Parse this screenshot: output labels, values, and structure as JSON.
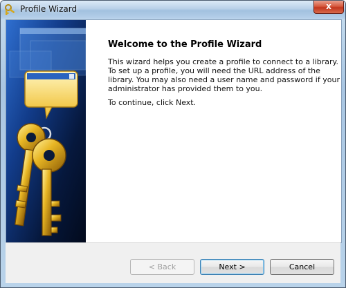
{
  "window": {
    "title": "Profile Wizard",
    "close_glyph": "x"
  },
  "page": {
    "heading": "Welcome to the Profile Wizard",
    "intro": "This wizard helps you create a profile to connect to a library. To set up a profile, you will need the URL address of the library. You may also need a user name and password if your administrator has provided them to you.",
    "continue_text": "To continue, click Next."
  },
  "buttons": {
    "back": "< Back",
    "next": "Next >",
    "cancel": "Cancel"
  },
  "icons": {
    "app": "keys-icon",
    "banner": "golden-keys-illustration"
  },
  "colors": {
    "close_button": "#c2351c",
    "banner_background": "#061633",
    "keys_gold": "#e0b020"
  }
}
